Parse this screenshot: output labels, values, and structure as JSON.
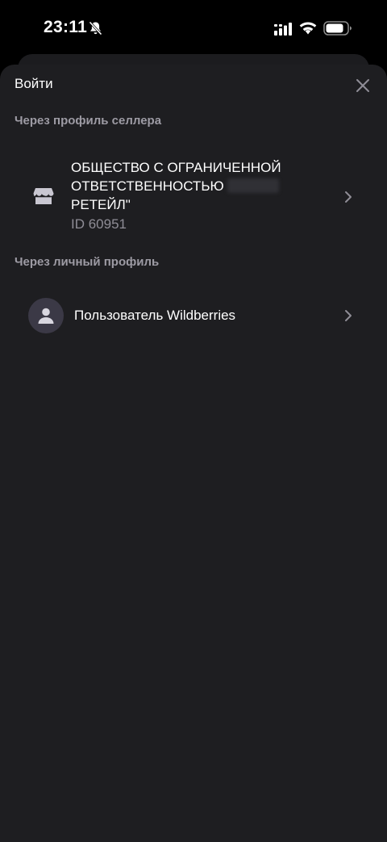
{
  "status_bar": {
    "time": "23:11",
    "icons": [
      "bell-off-icon",
      "signal-icon",
      "wifi-icon",
      "battery-icon"
    ]
  },
  "sheet": {
    "title": "Войти",
    "close_icon": "close-icon"
  },
  "seller_section": {
    "label": "Через профиль селлера",
    "item": {
      "icon": "shop-icon",
      "name_line1": "ОБЩЕСТВО С ОГРАНИЧЕННОЙ",
      "name_line2": "ОТВЕТСТВЕННОСТЬЮ",
      "name_line3": "РЕТЕЙЛ\"",
      "id": "ID 60951"
    }
  },
  "personal_section": {
    "label": "Через личный профиль",
    "item": {
      "icon": "user-icon",
      "label": "Пользователь Wildberries"
    }
  },
  "colors": {
    "background": "#000000",
    "sheet": "#1e1e21",
    "secondary_text": "#9d9ba4",
    "avatar_bg": "#3b3946"
  }
}
